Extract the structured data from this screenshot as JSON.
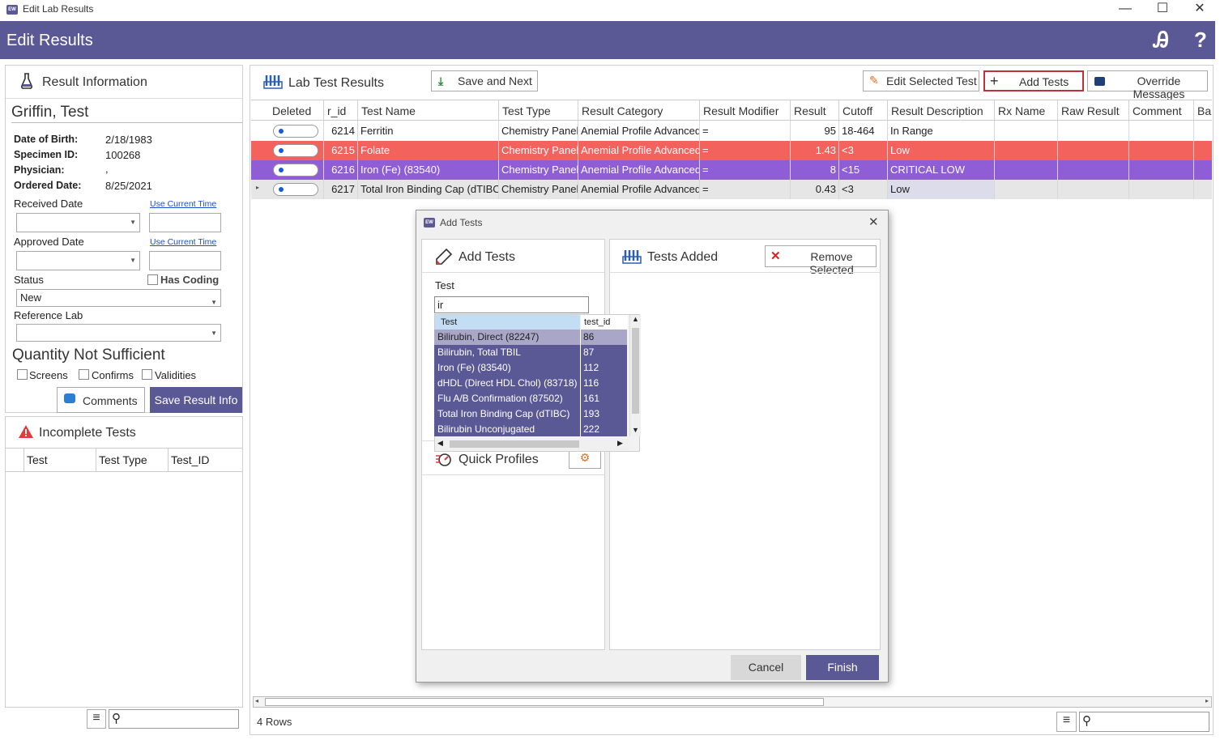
{
  "window": {
    "title": "Edit Lab Results",
    "minimize": "—",
    "maximize": "☐",
    "close": "✕",
    "app_icon_text": "EW"
  },
  "header": {
    "title": "Edit Results",
    "glasses_icon": "Ꭿ",
    "help": "?"
  },
  "left": {
    "section_title": "Result Information",
    "patient_name": "Griffin, Test",
    "dob_label": "Date of Birth:",
    "dob": "2/18/1983",
    "specimen_label": "Specimen ID:",
    "specimen": "100268",
    "physician_label": "Physician:",
    "physician": ",",
    "ordered_label": "Ordered Date:",
    "ordered": "8/25/2021",
    "received_label": "Received Date",
    "approved_label": "Approved Date",
    "use_current_time": "Use Current Time",
    "status_label": "Status",
    "status_value": "New",
    "has_coding": "Has Coding",
    "reference_lab_label": "Reference Lab",
    "qns_title": "Quantity Not Sufficient",
    "screens": "Screens",
    "confirms": "Confirms",
    "validities": "Validities",
    "comments_btn": "Comments",
    "save_btn": "Save Result Info",
    "incomplete_title": "Incomplete Tests",
    "incomplete_cols": [
      "Test",
      "Test Type",
      "Test_ID"
    ]
  },
  "right": {
    "section_title": "Lab Test Results",
    "save_next": "Save and Next",
    "edit_selected": "Edit Selected Test",
    "add_tests": "Add Tests",
    "override": "Override Messages",
    "columns": [
      "Deleted",
      "r_id",
      "Test Name",
      "Test Type",
      "Result Category",
      "Result Modifier",
      "Result",
      "Cutoff",
      "Result Description",
      "Rx Name",
      "Raw Result",
      "Comment",
      "Ba"
    ],
    "rows": [
      {
        "r_id": "6214",
        "name": "Ferritin",
        "type": "Chemistry Panel",
        "category": "Anemial Profile Advanced",
        "modifier": "=",
        "result": "95",
        "cutoff": "18-464",
        "desc": "In Range"
      },
      {
        "r_id": "6215",
        "name": "Folate",
        "type": "Chemistry Panel",
        "category": "Anemial Profile Advanced",
        "modifier": "=",
        "result": "1.43",
        "cutoff": "<3",
        "desc": "Low"
      },
      {
        "r_id": "6216",
        "name": "Iron (Fe) (83540)",
        "type": "Chemistry Panel",
        "category": "Anemial Profile Advanced",
        "modifier": "=",
        "result": "8",
        "cutoff": "<15",
        "desc": "CRITICAL LOW"
      },
      {
        "r_id": "6217",
        "name": "Total Iron Binding Cap (dTIBC)",
        "type": "Chemistry Panel",
        "category": "Anemial Profile Advanced",
        "modifier": "=",
        "result": "0.43",
        "cutoff": "<3",
        "desc": "Low"
      }
    ],
    "row_count": "4 Rows"
  },
  "dialog": {
    "title": "Add Tests",
    "add_title": "Add Tests",
    "added_title": "Tests Added",
    "remove_selected": "Remove Selected",
    "test_label": "Test",
    "search_value": "ir",
    "dd_cols": [
      "Test",
      "test_id"
    ],
    "dd_rows": [
      {
        "test": "Bilirubin, Direct (82247)",
        "id": "86"
      },
      {
        "test": "Bilirubin, Total TBIL",
        "id": "87"
      },
      {
        "test": "Iron (Fe) (83540)",
        "id": "112"
      },
      {
        "test": "dHDL (Direct HDL Chol) (83718)",
        "id": "116"
      },
      {
        "test": "Flu A/B Confirmation (87502)",
        "id": "161"
      },
      {
        "test": "Total Iron Binding Cap (dTIBC)",
        "id": "193"
      },
      {
        "test": "Bilirubin Unconjugated",
        "id": "222"
      }
    ],
    "quick_profiles": "Quick Profiles",
    "cancel": "Cancel",
    "finish": "Finish"
  },
  "colors": {
    "accent": "#5b5896",
    "row_red": "#f4625e",
    "row_purple": "#8f5ed6",
    "row_gray": "#e6e6e6"
  }
}
